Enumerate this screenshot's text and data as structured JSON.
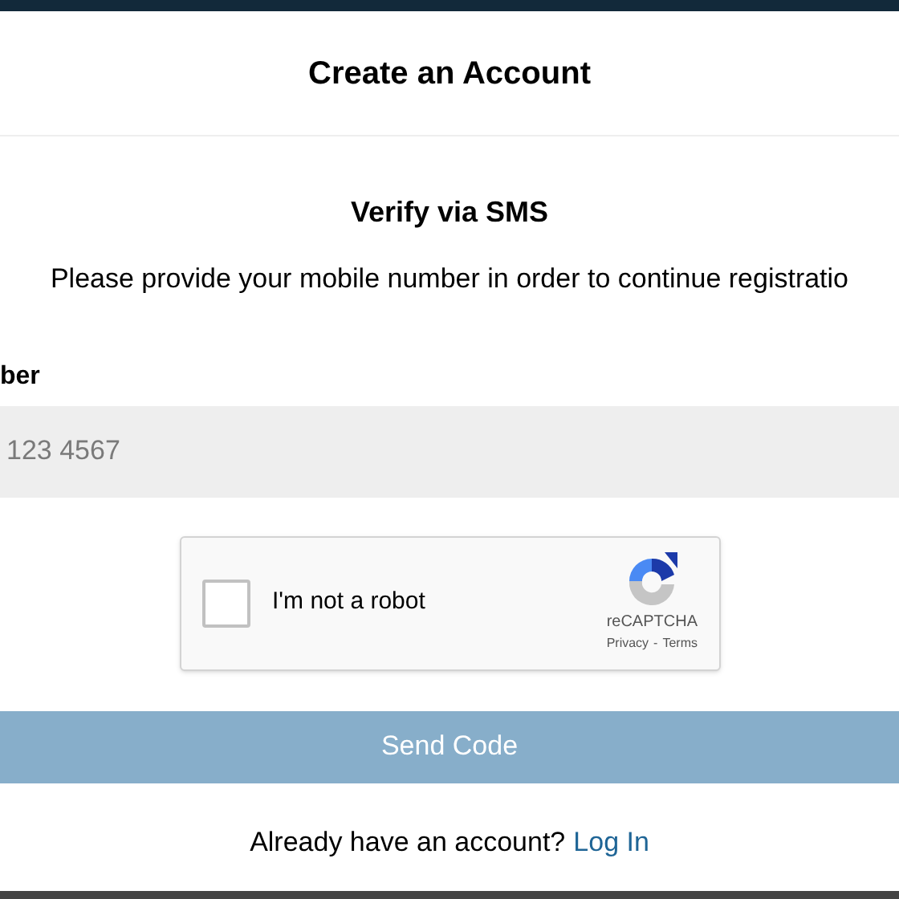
{
  "header": {
    "title": "Create an Account"
  },
  "section": {
    "title": "Verify via SMS",
    "description": "Please provide your mobile number in order to continue registratio"
  },
  "phone_field": {
    "label": "ber",
    "placeholder": "123 4567"
  },
  "captcha": {
    "label": "I'm not a robot",
    "checked": false,
    "brand": "reCAPTCHA",
    "privacy": "Privacy",
    "separator": "-",
    "terms": "Terms"
  },
  "submit": {
    "label": "Send Code",
    "disabled": true
  },
  "footer": {
    "text": "Already have an account?",
    "link": "Log In"
  }
}
